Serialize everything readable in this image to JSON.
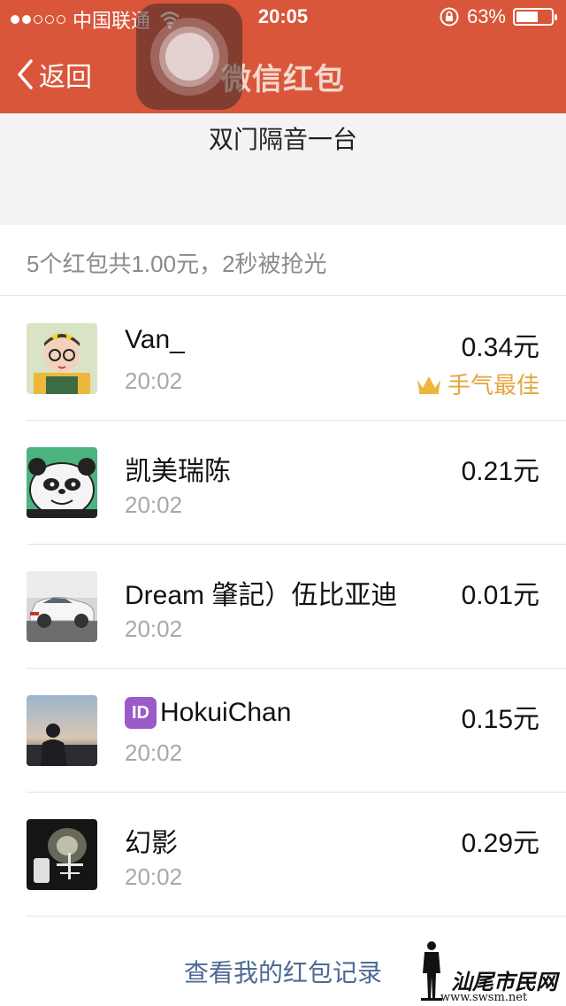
{
  "status_bar": {
    "carrier": "中国联通",
    "time": "20:05",
    "battery": "63%",
    "battery_level": 0.63,
    "signal_bars_filled": 2,
    "signal_bars_total": 5
  },
  "nav": {
    "back_label": "返回",
    "title": "微信红包"
  },
  "packet": {
    "message": "双门隔音一台",
    "summary": "5个红包共1.00元，2秒被抢光"
  },
  "claims": [
    {
      "name": "Van_",
      "time": "20:02",
      "amount": "0.34元",
      "best_luck": "手气最佳",
      "avatar": "girl-photo-avatar"
    },
    {
      "name": "凯美瑞陈",
      "time": "20:02",
      "amount": "0.21元",
      "avatar": "panda-cartoon-avatar"
    },
    {
      "name": "Dream 肇記）伍比亚迪",
      "time": "20:02",
      "amount": "0.01元",
      "avatar": "white-car-avatar"
    },
    {
      "name": "HokuiChan",
      "time": "20:02",
      "amount": "0.15元",
      "badge": "ID",
      "avatar": "silhouette-sunset-avatar"
    },
    {
      "name": "幻影",
      "time": "20:02",
      "amount": "0.29元",
      "avatar": "dark-poster-avatar"
    }
  ],
  "footer": {
    "records_link": "查看我的红包记录"
  },
  "watermark": {
    "text": "汕尾市民网",
    "url": "www.swsm.net"
  },
  "colors": {
    "header_red": "#d9563a",
    "link_blue": "#4d6a93",
    "gold": "#e7a53c"
  }
}
